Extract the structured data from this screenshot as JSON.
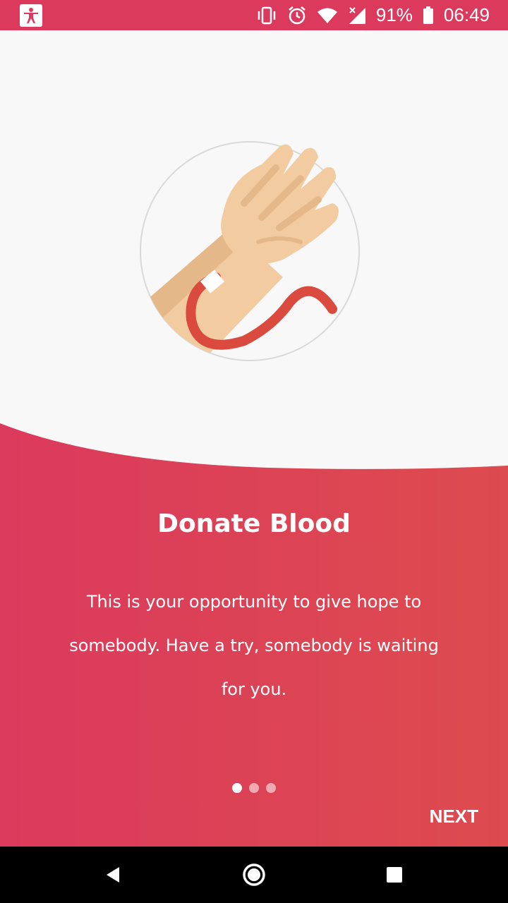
{
  "status_bar": {
    "app_icon": "accessibility-person-icon",
    "icons": [
      "vibrate-icon",
      "alarm-icon",
      "wifi-icon",
      "signal-icon",
      "battery-icon"
    ],
    "battery": "91%",
    "time": "06:49"
  },
  "onboarding": {
    "illustration": "hand-blood-donation-illustration",
    "title": "Donate Blood",
    "description": "This is your opportunity to give hope to somebody. Have a try, somebody is waiting for you.",
    "page_count": 3,
    "current_page": 1,
    "next_label": "NEXT"
  },
  "colors": {
    "accent": "#dc3a5d",
    "accent_end": "#dd4b4e",
    "background": "#f8f8f8"
  },
  "nav_bar": {
    "buttons": [
      "back-icon",
      "home-icon",
      "recents-icon"
    ]
  }
}
